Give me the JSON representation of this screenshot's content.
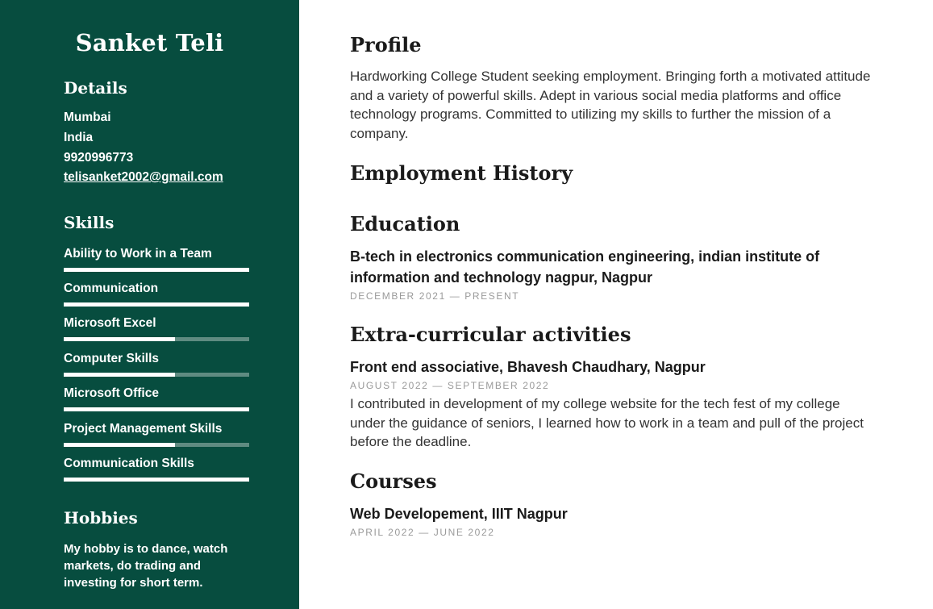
{
  "name": "Sanket Teli",
  "details": {
    "heading": "Details",
    "city": "Mumbai",
    "country": "India",
    "phone": "9920996773",
    "email": "telisanket2002@gmail.com"
  },
  "skills": {
    "heading": "Skills",
    "items": [
      {
        "label": "Ability to Work in a Team",
        "level": 1.0
      },
      {
        "label": "Communication",
        "level": 1.0
      },
      {
        "label": "Microsoft Excel",
        "level": 0.6
      },
      {
        "label": "Computer Skills",
        "level": 0.6
      },
      {
        "label": "Microsoft Office",
        "level": 1.0
      },
      {
        "label": "Project Management Skills",
        "level": 0.6
      },
      {
        "label": "Communication Skills",
        "level": 1.0
      }
    ]
  },
  "hobbies": {
    "heading": "Hobbies",
    "text": "My hobby is to dance, watch markets, do trading and investing for short term."
  },
  "profile": {
    "heading": "Profile",
    "text": "Hardworking College Student seeking employment. Bringing forth a motivated attitude and a variety of powerful skills. Adept in various social media platforms and office technology programs. Committed to utilizing my skills to further the mission of a company."
  },
  "employment": {
    "heading": "Employment History"
  },
  "education": {
    "heading": "Education",
    "title": "B-tech in electronics communication engineering, indian institute of information and technology nagpur, Nagpur",
    "date": "December 2021 — Present"
  },
  "extracurricular": {
    "heading": "Extra-curricular activities",
    "title": "Front end associative, Bhavesh Chaudhary, Nagpur",
    "date": "August 2022 — September 2022",
    "text": "I contributed in development of my college website for the tech fest of my college under the guidance of seniors, I learned how to work in a team and pull of the project before the deadline."
  },
  "courses": {
    "heading": "Courses",
    "title": "Web Developement, IIIT Nagpur",
    "date": "April 2022 — June 2022"
  }
}
